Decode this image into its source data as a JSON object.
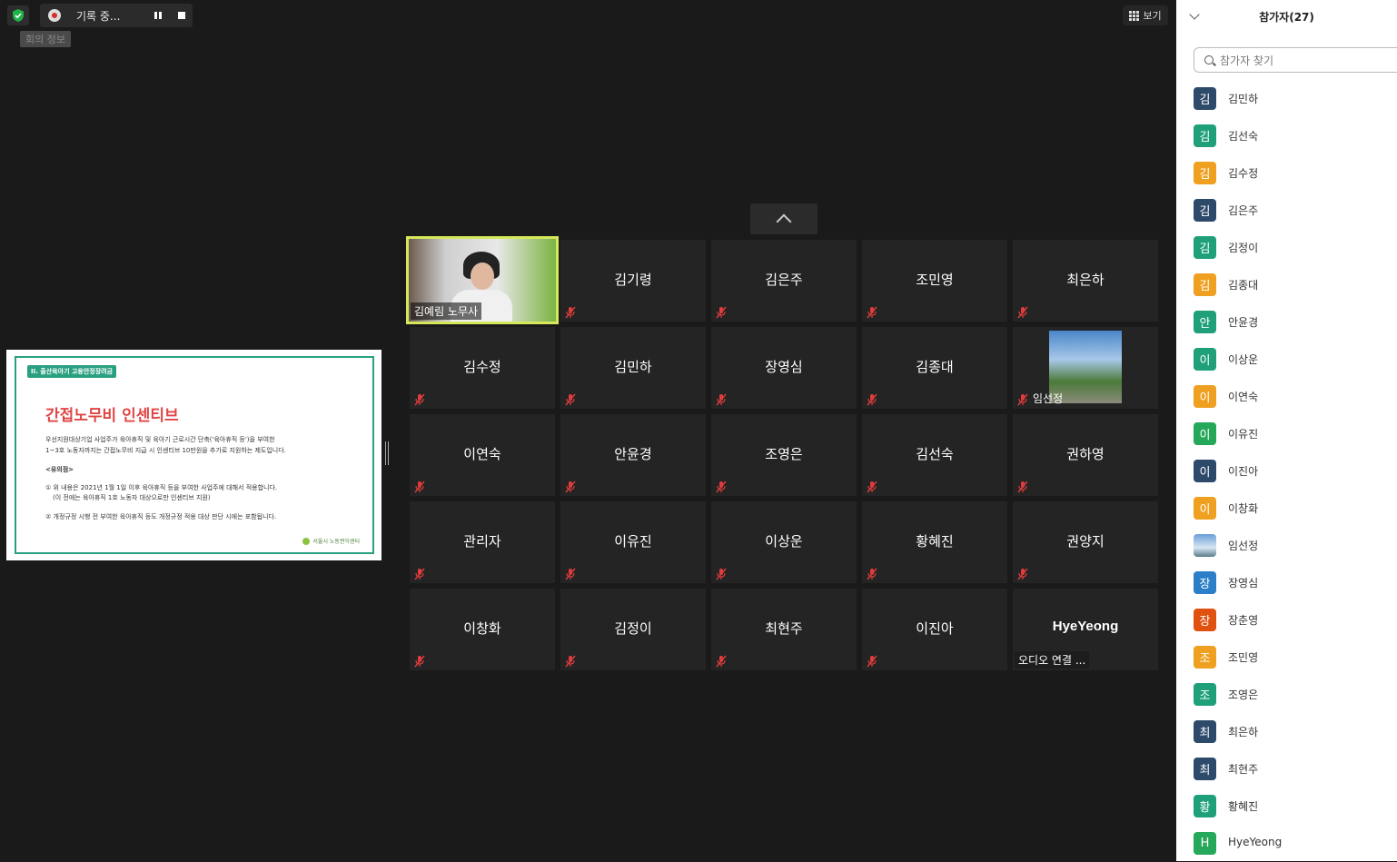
{
  "top_bar": {
    "recording_label": "기록 중...",
    "meeting_info_label": "회의 정보",
    "view_label": "보기"
  },
  "slide": {
    "tag": "II. 출산육아기 고용안정장려금",
    "title": "간접노무비 인센티브",
    "line1": "우선지원대상기업 사업주가 육아휴직 및 육아기 근로시간 단축('육아휴직 등')을 부여한",
    "line2": "1~3호 노동자까지는 간접노무비 지급 시 인센티브 10만원을 추가로 지원하는 제도입니다.",
    "line3": "<유의점>",
    "line4": "① 위 내용은 2021년 1월 1일 이후 육아휴직 등을 부여한 사업주에 대해서 적용합니다.",
    "line5": "(이 전에는 육아휴직 1호 노동자 대상으로만 인센티브 지원)",
    "line6": "② 개정규정 시행 전 부여한 육아휴직 등도 개정규정 적용 대상 판단 시에는 포함됩니다.",
    "footer": "서울시 노동권익센터"
  },
  "tiles": [
    {
      "name": "김예림 노무사"
    },
    {
      "name": "김기령"
    },
    {
      "name": "김은주"
    },
    {
      "name": "조민영"
    },
    {
      "name": "최은하"
    },
    {
      "name": "김수정"
    },
    {
      "name": "김민하"
    },
    {
      "name": "장영심"
    },
    {
      "name": "김종대"
    },
    {
      "name": "임선정"
    },
    {
      "name": "이연숙"
    },
    {
      "name": "안윤경"
    },
    {
      "name": "조영은"
    },
    {
      "name": "김선숙"
    },
    {
      "name": "권하영"
    },
    {
      "name": "관리자"
    },
    {
      "name": "이유진"
    },
    {
      "name": "이상운"
    },
    {
      "name": "황혜진"
    },
    {
      "name": "권양지"
    },
    {
      "name": "이창화"
    },
    {
      "name": "김정이"
    },
    {
      "name": "최현주"
    },
    {
      "name": "이진아"
    },
    {
      "name": "HyeYeong",
      "audio_label": "오디오 연결 ..."
    }
  ],
  "panel": {
    "title": "참가자(27)",
    "search_placeholder": "참가자 찾기",
    "participants": [
      {
        "initial": "김",
        "name": "김민하",
        "color": "#2e4a6b"
      },
      {
        "initial": "김",
        "name": "김선숙",
        "color": "#1fa07a"
      },
      {
        "initial": "김",
        "name": "김수정",
        "color": "#f0a020"
      },
      {
        "initial": "김",
        "name": "김은주",
        "color": "#2e4a6b"
      },
      {
        "initial": "김",
        "name": "김정이",
        "color": "#1fa07a"
      },
      {
        "initial": "김",
        "name": "김종대",
        "color": "#f0a020"
      },
      {
        "initial": "안",
        "name": "안윤경",
        "color": "#1fa07a"
      },
      {
        "initial": "이",
        "name": "이상운",
        "color": "#1fa07a"
      },
      {
        "initial": "이",
        "name": "이연숙",
        "color": "#f0a020"
      },
      {
        "initial": "이",
        "name": "이유진",
        "color": "#26a85a"
      },
      {
        "initial": "이",
        "name": "이진아",
        "color": "#2e4a6b"
      },
      {
        "initial": "이",
        "name": "이창화",
        "color": "#f0a020"
      },
      {
        "initial": "",
        "name": "임선정",
        "color": "photo"
      },
      {
        "initial": "장",
        "name": "장영심",
        "color": "#2a7fc8"
      },
      {
        "initial": "장",
        "name": "장춘영",
        "color": "#e05010"
      },
      {
        "initial": "조",
        "name": "조민영",
        "color": "#f0a020"
      },
      {
        "initial": "조",
        "name": "조영은",
        "color": "#1fa07a"
      },
      {
        "initial": "최",
        "name": "최은하",
        "color": "#2e4a6b"
      },
      {
        "initial": "최",
        "name": "최현주",
        "color": "#2e4a6b"
      },
      {
        "initial": "황",
        "name": "황혜진",
        "color": "#1fa07a"
      },
      {
        "initial": "H",
        "name": "HyeYeong",
        "color": "#26a85a"
      }
    ]
  }
}
